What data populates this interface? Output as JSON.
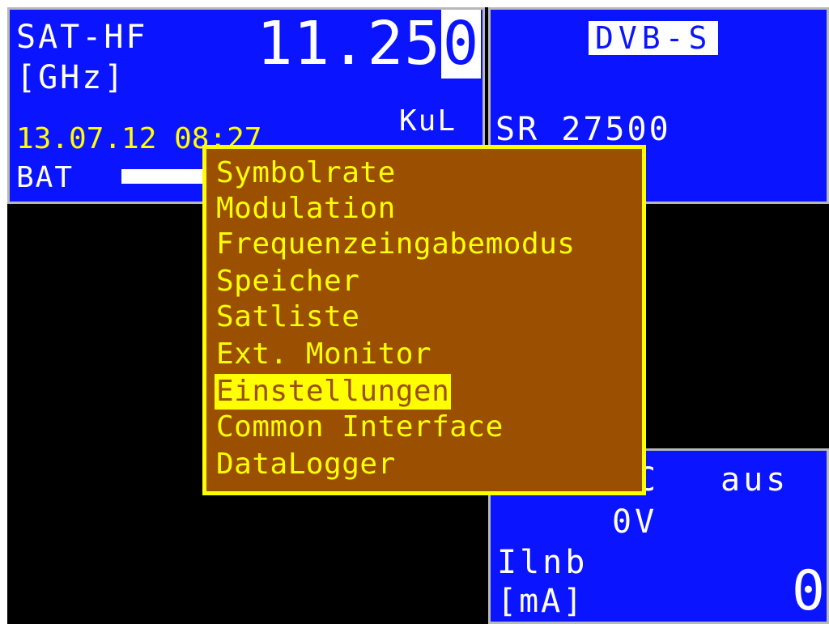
{
  "top_left": {
    "label_line1": "SAT-HF",
    "label_line2": "[GHz]",
    "frequency_main": "11.25",
    "frequency_cursor_digit": "0",
    "band": "KuL",
    "datetime": "13.07.12 08:27",
    "battery_label": "BAT"
  },
  "top_right": {
    "standard": "DVB-S",
    "symbolrate": "SR 27500"
  },
  "bottom_right": {
    "setting_label_fragment": "C",
    "setting_value": "aus",
    "voltage": "0V",
    "current_label": "Ilnb",
    "current_unit": "[mA]",
    "current_value": "0"
  },
  "menu": {
    "items": [
      "Symbolrate",
      "Modulation",
      "Frequenzeingabemodus",
      "Speicher",
      "Satliste",
      "Ext. Monitor",
      "Einstellungen",
      "Common Interface",
      "DataLogger"
    ],
    "selected_item": "Einstellungen"
  },
  "colors": {
    "panel_blue": "#0a14ff",
    "menu_brown": "#9b4f00",
    "menu_yellow": "#ffff00",
    "screen_black": "#000000"
  }
}
